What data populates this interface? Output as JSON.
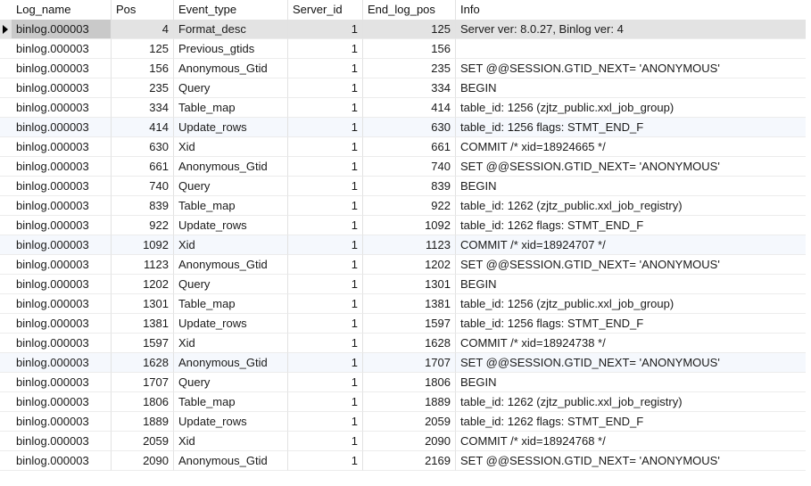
{
  "columns": {
    "log_name": "Log_name",
    "pos": "Pos",
    "event_type": "Event_type",
    "server_id": "Server_id",
    "end_log_pos": "End_log_pos",
    "info": "Info"
  },
  "selected_row": 0,
  "rows": [
    {
      "log_name": "binlog.000003",
      "pos": "4",
      "event_type": "Format_desc",
      "server_id": "1",
      "end_log_pos": "125",
      "info": "Server ver: 8.0.27, Binlog ver: 4"
    },
    {
      "log_name": "binlog.000003",
      "pos": "125",
      "event_type": "Previous_gtids",
      "server_id": "1",
      "end_log_pos": "156",
      "info": ""
    },
    {
      "log_name": "binlog.000003",
      "pos": "156",
      "event_type": "Anonymous_Gtid",
      "server_id": "1",
      "end_log_pos": "235",
      "info": "SET @@SESSION.GTID_NEXT= 'ANONYMOUS'"
    },
    {
      "log_name": "binlog.000003",
      "pos": "235",
      "event_type": "Query",
      "server_id": "1",
      "end_log_pos": "334",
      "info": "BEGIN"
    },
    {
      "log_name": "binlog.000003",
      "pos": "334",
      "event_type": "Table_map",
      "server_id": "1",
      "end_log_pos": "414",
      "info": "table_id: 1256 (zjtz_public.xxl_job_group)"
    },
    {
      "log_name": "binlog.000003",
      "pos": "414",
      "event_type": "Update_rows",
      "server_id": "1",
      "end_log_pos": "630",
      "info": "table_id: 1256 flags: STMT_END_F"
    },
    {
      "log_name": "binlog.000003",
      "pos": "630",
      "event_type": "Xid",
      "server_id": "1",
      "end_log_pos": "661",
      "info": "COMMIT /* xid=18924665 */"
    },
    {
      "log_name": "binlog.000003",
      "pos": "661",
      "event_type": "Anonymous_Gtid",
      "server_id": "1",
      "end_log_pos": "740",
      "info": "SET @@SESSION.GTID_NEXT= 'ANONYMOUS'"
    },
    {
      "log_name": "binlog.000003",
      "pos": "740",
      "event_type": "Query",
      "server_id": "1",
      "end_log_pos": "839",
      "info": "BEGIN"
    },
    {
      "log_name": "binlog.000003",
      "pos": "839",
      "event_type": "Table_map",
      "server_id": "1",
      "end_log_pos": "922",
      "info": "table_id: 1262 (zjtz_public.xxl_job_registry)"
    },
    {
      "log_name": "binlog.000003",
      "pos": "922",
      "event_type": "Update_rows",
      "server_id": "1",
      "end_log_pos": "1092",
      "info": "table_id: 1262 flags: STMT_END_F"
    },
    {
      "log_name": "binlog.000003",
      "pos": "1092",
      "event_type": "Xid",
      "server_id": "1",
      "end_log_pos": "1123",
      "info": "COMMIT /* xid=18924707 */"
    },
    {
      "log_name": "binlog.000003",
      "pos": "1123",
      "event_type": "Anonymous_Gtid",
      "server_id": "1",
      "end_log_pos": "1202",
      "info": "SET @@SESSION.GTID_NEXT= 'ANONYMOUS'"
    },
    {
      "log_name": "binlog.000003",
      "pos": "1202",
      "event_type": "Query",
      "server_id": "1",
      "end_log_pos": "1301",
      "info": "BEGIN"
    },
    {
      "log_name": "binlog.000003",
      "pos": "1301",
      "event_type": "Table_map",
      "server_id": "1",
      "end_log_pos": "1381",
      "info": "table_id: 1256 (zjtz_public.xxl_job_group)"
    },
    {
      "log_name": "binlog.000003",
      "pos": "1381",
      "event_type": "Update_rows",
      "server_id": "1",
      "end_log_pos": "1597",
      "info": "table_id: 1256 flags: STMT_END_F"
    },
    {
      "log_name": "binlog.000003",
      "pos": "1597",
      "event_type": "Xid",
      "server_id": "1",
      "end_log_pos": "1628",
      "info": "COMMIT /* xid=18924738 */"
    },
    {
      "log_name": "binlog.000003",
      "pos": "1628",
      "event_type": "Anonymous_Gtid",
      "server_id": "1",
      "end_log_pos": "1707",
      "info": "SET @@SESSION.GTID_NEXT= 'ANONYMOUS'"
    },
    {
      "log_name": "binlog.000003",
      "pos": "1707",
      "event_type": "Query",
      "server_id": "1",
      "end_log_pos": "1806",
      "info": "BEGIN"
    },
    {
      "log_name": "binlog.000003",
      "pos": "1806",
      "event_type": "Table_map",
      "server_id": "1",
      "end_log_pos": "1889",
      "info": "table_id: 1262 (zjtz_public.xxl_job_registry)"
    },
    {
      "log_name": "binlog.000003",
      "pos": "1889",
      "event_type": "Update_rows",
      "server_id": "1",
      "end_log_pos": "2059",
      "info": "table_id: 1262 flags: STMT_END_F"
    },
    {
      "log_name": "binlog.000003",
      "pos": "2059",
      "event_type": "Xid",
      "server_id": "1",
      "end_log_pos": "2090",
      "info": "COMMIT /* xid=18924768 */"
    },
    {
      "log_name": "binlog.000003",
      "pos": "2090",
      "event_type": "Anonymous_Gtid",
      "server_id": "1",
      "end_log_pos": "2169",
      "info": "SET @@SESSION.GTID_NEXT= 'ANONYMOUS'"
    }
  ]
}
